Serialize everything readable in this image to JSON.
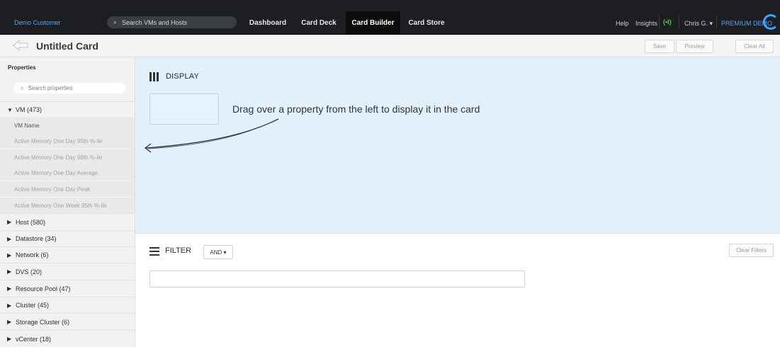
{
  "nav": {
    "brand": "Demo Customer",
    "search_placeholder": "Search VMs and Hosts",
    "tabs": [
      {
        "label": "Dashboard"
      },
      {
        "label": "Card Deck"
      },
      {
        "label": "Card Builder",
        "active": true
      },
      {
        "label": "Card Store"
      }
    ],
    "help": "Help",
    "insights": "Insights",
    "signal_glyph": "(•I)",
    "user": "Chris G. ▾",
    "premium": "PREMIUM DEMO"
  },
  "titlebar": {
    "title": "Untitled Card",
    "save": "Save",
    "preview": "Preview",
    "clear_all": "Clear All"
  },
  "sidebar": {
    "title": "Properties",
    "search_placeholder": "Search properties",
    "vm_group": {
      "label": "VM (473)",
      "expanded": true
    },
    "vm_children": [
      "VM Name",
      "Active Memory One Day 95th %-ile",
      "Active Memory One Day 99th %-ile",
      "Active Memory One Day Average",
      "Active Memory One Day Peak",
      "Active Memory One Week 95th %-ile"
    ],
    "groups": [
      "Host (580)",
      "Datastore (34)",
      "Network (6)",
      "DVS (20)",
      "Resource Pool (47)",
      "Cluster (45)",
      "Storage Cluster (6)",
      "vCenter (18)"
    ]
  },
  "display": {
    "title": "DISPLAY",
    "hint": "Drag over a property from the left to display it in the card"
  },
  "filter": {
    "title": "FILTER",
    "operator": "AND ▾",
    "clear": "Clear Filters"
  },
  "colors": {
    "nav_bg": "#1c1e22",
    "accent_blue": "#4da6ff",
    "display_bg": "#e1f0fb",
    "signal_green": "#4ed04a"
  }
}
